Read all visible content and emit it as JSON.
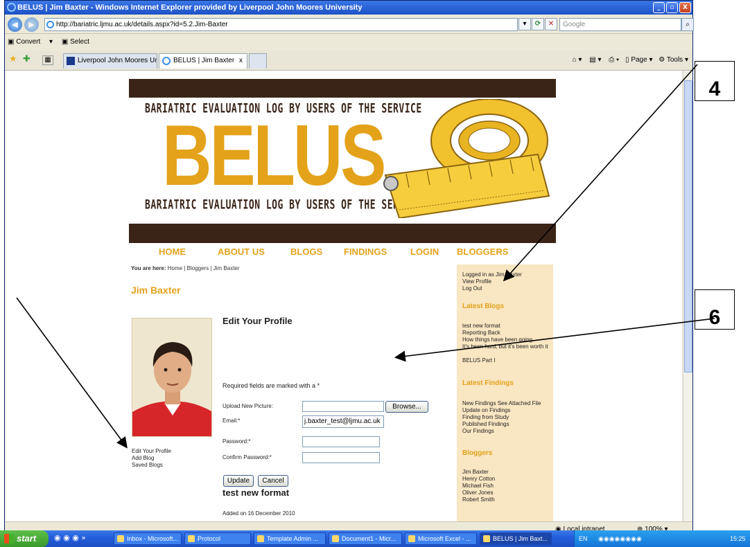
{
  "window": {
    "title": "BELUS | Jim Baxter - Windows Internet Explorer provided by Liverpool John Moores University",
    "controls": [
      "_",
      "▫",
      "X"
    ]
  },
  "addressbar": {
    "url": "http://bariatric.ljmu.ac.uk/details.aspx?id=5.2.Jim-Baxter",
    "search_placeholder": "Google"
  },
  "cmdbar": {
    "convert": "Convert",
    "select": "Select"
  },
  "tabs": [
    {
      "label": "Liverpool John Moores Unive..."
    },
    {
      "label": "BELUS | Jim Baxter"
    }
  ],
  "ie_commands": {
    "page": "Page",
    "tools": "Tools"
  },
  "status": {
    "zone": "Local intranet",
    "zoom": "100%"
  },
  "site": {
    "tagline_top": "BARIATRIC EVALUATION LOG BY USERS OF THE SERVICE",
    "logo": "BELUS",
    "tagline_bottom": "BARIATRIC EVALUATION LOG BY USERS OF THE SERVICE",
    "nav": [
      "HOME",
      "ABOUT US",
      "BLOGS",
      "FINDINGS",
      "LOGIN",
      "BLOGGERS"
    ],
    "breadcrumb_label": "You are here:",
    "breadcrumb_path": "Home | Bloggers | Jim Baxter",
    "user_name": "Jim Baxter",
    "left_links": [
      "Edit Your Profile",
      "Add Blog",
      "Saved Blogs"
    ],
    "form": {
      "title": "Edit Your Profile",
      "required_note": "Required fields are marked with a *",
      "upload_label": "Upload New Picture:",
      "browse": "Browse...",
      "email_label": "Email:*",
      "email_value": "j.baxter_test@ljmu.ac.uk",
      "password_label": "Password:*",
      "confirm_label": "Confirm Password:*",
      "update": "Update",
      "cancel": "Cancel"
    },
    "post": {
      "title": "test new format",
      "added": "Added on 16 December 2010"
    },
    "sidebar": {
      "logged_in": "Logged in as Jim Baxter",
      "view_profile": "View Profile",
      "log_out": "Log Out",
      "latest_blogs_head": "Latest Blogs",
      "latest_blogs": [
        "test new format",
        "Reporting Back",
        "How things have been going",
        "It's been hard, but it's been worth it",
        "BELUS Part I"
      ],
      "latest_findings_head": "Latest Findings",
      "latest_findings": [
        "New Findings See Attached File",
        "Update on Findings",
        "Finding from Study",
        "Published Findings",
        "Our Findings"
      ],
      "bloggers_head": "Bloggers",
      "bloggers": [
        "Jim Baxter",
        "Henry Cotton",
        "Michael Fish",
        "Oliver Jones",
        "Robert Smith"
      ]
    }
  },
  "taskbar": {
    "start": "start",
    "tasks": [
      "Inbox - Microsoft...",
      "Protocol",
      "Template Admin ...",
      "Document1 - Micr...",
      "Microsoft Excel - ...",
      "BELUS | Jim Baxt..."
    ],
    "lang": "EN",
    "clock": "15:25"
  },
  "callouts": {
    "top": "4",
    "mid": "6"
  },
  "colors": {
    "accent": "#e3a21a",
    "brown": "#3a2418",
    "sidebar": "#f9e6c2"
  }
}
